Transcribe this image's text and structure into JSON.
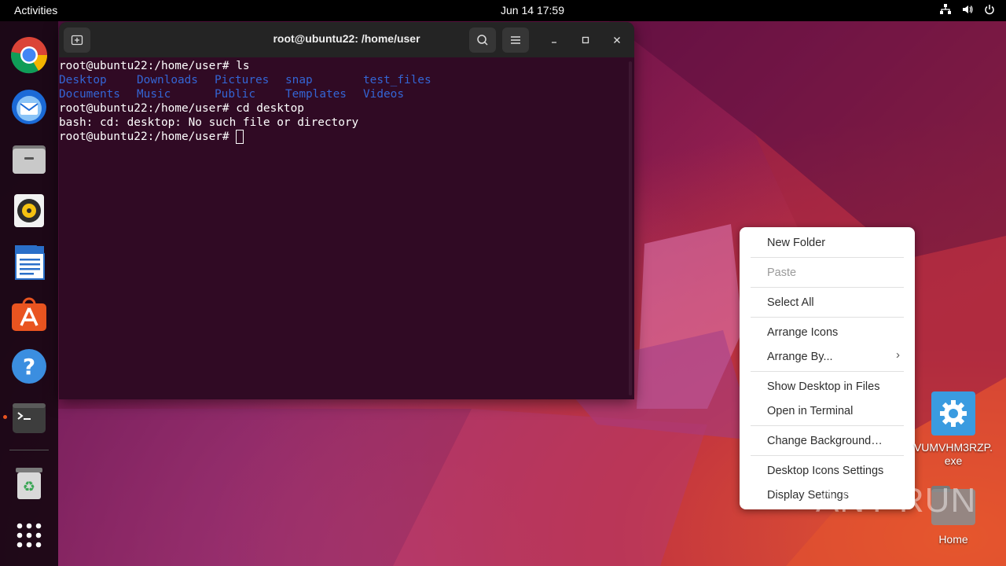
{
  "topbar": {
    "activities": "Activities",
    "clock": "Jun 14  17:59",
    "tray_icons": [
      "network-icon",
      "volume-icon",
      "power-icon"
    ]
  },
  "dock": {
    "items": [
      {
        "name": "chrome",
        "icon": "chrome-icon"
      },
      {
        "name": "thunderbird",
        "icon": "thunderbird-icon"
      },
      {
        "name": "files",
        "icon": "files-icon"
      },
      {
        "name": "rhythmbox",
        "icon": "rhythmbox-icon"
      },
      {
        "name": "writer",
        "icon": "writer-icon"
      },
      {
        "name": "software",
        "icon": "software-icon"
      },
      {
        "name": "help",
        "icon": "help-icon"
      },
      {
        "name": "terminal",
        "icon": "terminal-icon",
        "running": true
      },
      {
        "name": "trash",
        "icon": "trash-icon"
      },
      {
        "name": "show-apps",
        "icon": "apps-grid-icon"
      }
    ]
  },
  "terminal": {
    "title": "root@ubuntu22: /home/user",
    "prompt": "root@ubuntu22:/home/user#",
    "lines": [
      {
        "type": "cmd",
        "text": " ls"
      },
      {
        "type": "ls",
        "cells": [
          "Desktop",
          "Downloads",
          "Pictures",
          "snap",
          "test_files"
        ]
      },
      {
        "type": "ls",
        "cells": [
          "Documents",
          "Music",
          "Public",
          "Templates",
          "Videos"
        ]
      },
      {
        "type": "cmd",
        "text": " cd desktop"
      },
      {
        "type": "out",
        "text": "bash: cd: desktop: No such file or directory"
      },
      {
        "type": "cmd",
        "text": " "
      }
    ]
  },
  "context_menu": {
    "items": [
      {
        "label": "New Folder",
        "disabled": false
      },
      {
        "label": "Paste",
        "disabled": true
      },
      {
        "label": "Select All",
        "disabled": false
      },
      {
        "label": "Arrange Icons",
        "disabled": false
      },
      {
        "label": "Arrange By...",
        "disabled": false,
        "submenu": true
      },
      {
        "label": "Show Desktop in Files",
        "disabled": false
      },
      {
        "label": "Open in Terminal",
        "disabled": false
      },
      {
        "label": "Change Background…",
        "disabled": false
      },
      {
        "label": "Desktop Icons Settings",
        "disabled": false
      },
      {
        "label": "Display Settings",
        "disabled": false
      }
    ]
  },
  "desktop": {
    "icons": [
      {
        "label": "VUMVHM3RZP.exe",
        "line1": "VUMVHM3RZP.",
        "line2": "exe",
        "icon": "exe-gear-icon"
      },
      {
        "label": "Home",
        "icon": "home-folder-icon"
      }
    ]
  },
  "watermark": "ANY RUN",
  "colors": {
    "terminal_bg": "#300a24",
    "ls_dir": "#3465d4",
    "accent": "#e95420"
  }
}
